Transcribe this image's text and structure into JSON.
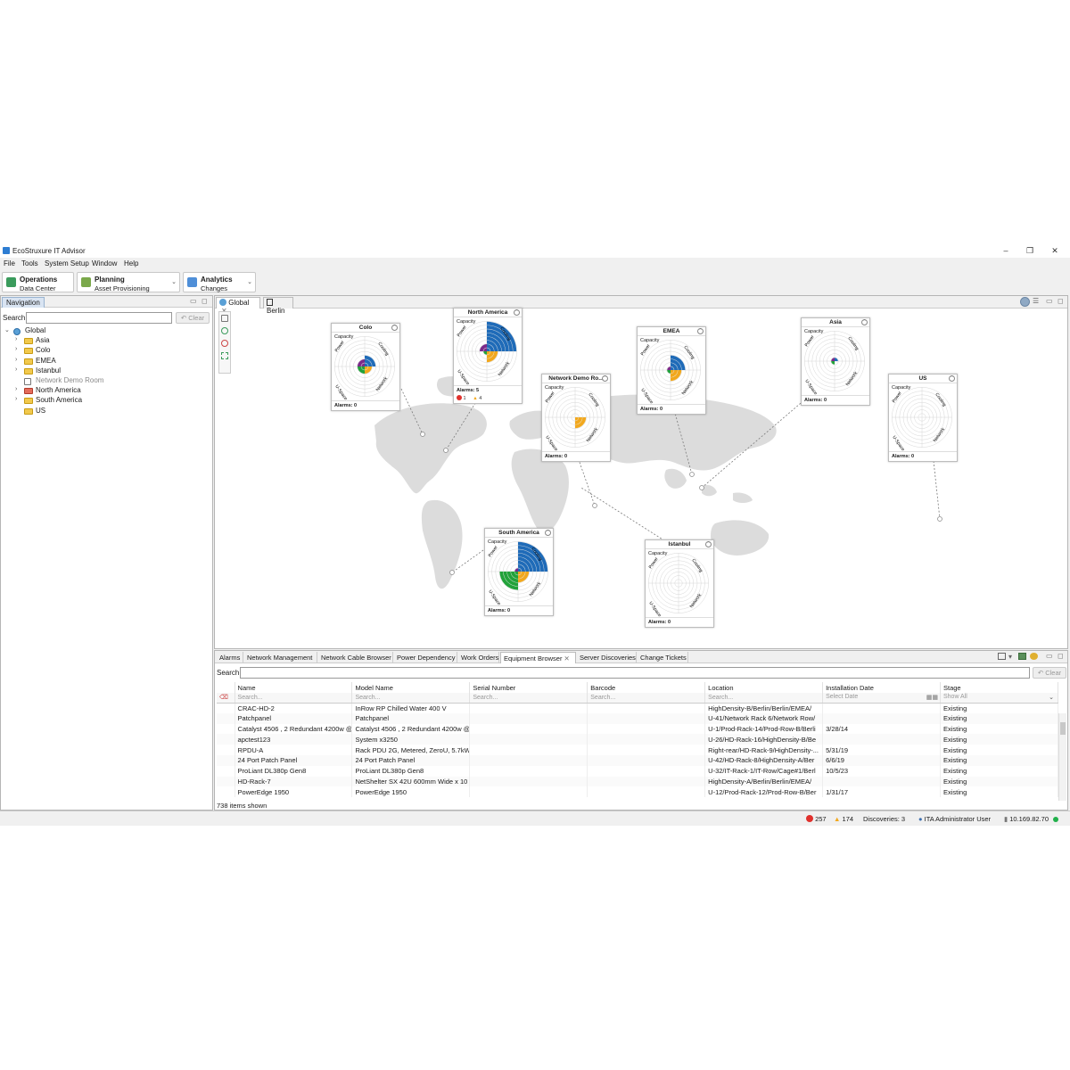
{
  "window": {
    "title": "EcoStruxure IT Advisor",
    "minimize": "–",
    "restore": "❐",
    "close": "✕"
  },
  "menu": [
    "File",
    "Tools",
    "System Setup",
    "Window",
    "Help"
  ],
  "perspectives": [
    {
      "title": "Operations",
      "subtitle": "Data Center",
      "icon": "operations-icon",
      "color": "#3a9b5c"
    },
    {
      "title": "Planning",
      "subtitle": "Asset Provisioning",
      "icon": "planning-icon",
      "color": "#7aa84a",
      "dropdown": "⌄"
    },
    {
      "title": "Analytics",
      "subtitle": "Changes",
      "icon": "analytics-icon",
      "color": "#4f8fd8",
      "dropdown": "⌄"
    }
  ],
  "navigation": {
    "tab": "Navigation",
    "search_label": "Search:",
    "search_value": "",
    "clear_label": "Clear",
    "tree": [
      {
        "label": "Global",
        "level": 0,
        "expanded": true,
        "type": "globe"
      },
      {
        "label": "Asia",
        "level": 1,
        "type": "folder"
      },
      {
        "label": "Colo",
        "level": 1,
        "type": "folder"
      },
      {
        "label": "EMEA",
        "level": 1,
        "type": "folder"
      },
      {
        "label": "Istanbul",
        "level": 1,
        "type": "folder"
      },
      {
        "label": "Network Demo Room",
        "level": 1,
        "type": "room",
        "muted": true
      },
      {
        "label": "North America",
        "level": 1,
        "type": "folder-red"
      },
      {
        "label": "South America",
        "level": 1,
        "type": "folder"
      },
      {
        "label": "US",
        "level": 1,
        "type": "folder",
        "leaf": true
      }
    ]
  },
  "map": {
    "tabs": [
      "Global",
      "Berlin"
    ],
    "capacity_label": "Capacity",
    "axis_labels": {
      "power": "Power",
      "cooling": "Cooling",
      "uspace": "U-Space",
      "network": "Network"
    },
    "alarms_prefix": "Alarms: ",
    "cards": [
      {
        "title": "Colo",
        "alarms": "0",
        "power": 2,
        "cooling": 3,
        "uspace": 2,
        "network": 2
      },
      {
        "title": "North America",
        "alarms": "5",
        "power": 2,
        "cooling": 8,
        "uspace": 1,
        "network": 3,
        "critical": "1",
        "warning": "4"
      },
      {
        "title": "Network Demo Ro...",
        "alarms": "0",
        "power": 0,
        "cooling": 0,
        "uspace": 0,
        "network": 3
      },
      {
        "title": "EMEA",
        "alarms": "0",
        "power": 1,
        "cooling": 4,
        "uspace": 1,
        "network": 3
      },
      {
        "title": "Asia",
        "alarms": "0",
        "power": 1,
        "cooling": 1,
        "uspace": 1,
        "network": 0
      },
      {
        "title": "US",
        "alarms": "0",
        "power": 0,
        "cooling": 0,
        "uspace": 0,
        "network": 0
      },
      {
        "title": "South America",
        "alarms": "0",
        "power": 1,
        "cooling": 8,
        "uspace": 5,
        "network": 3
      },
      {
        "title": "Istanbul",
        "alarms": "0",
        "power": 0,
        "cooling": 0,
        "uspace": 0,
        "network": 0
      }
    ]
  },
  "bottom": {
    "tabs": [
      "Alarms",
      "Network Management",
      "Network Cable Browser",
      "Power Dependency",
      "Work Orders",
      "Equipment Browser",
      "Server Discoveries",
      "Change Tickets"
    ],
    "active_tab": "Equipment Browser",
    "search_label": "Search:",
    "clear_label": "Clear",
    "columns": [
      "Name",
      "Model Name",
      "Serial Number",
      "Barcode",
      "Location",
      "Installation Date",
      "Stage"
    ],
    "filters": [
      "Search...",
      "Search...",
      "Search...",
      "Search...",
      "Search...",
      "Select Date",
      "Show All"
    ],
    "rows": [
      [
        "CRAC-HD-2",
        "InRow RP Chilled Water 400 V",
        "",
        "",
        "HighDensity-B/Berlin/Berlin/EMEA/",
        "",
        "Existing"
      ],
      [
        "Patchpanel",
        "Patchpanel",
        "",
        "",
        "U-41/Network Rack 6/Network Row/",
        "",
        "Existing"
      ],
      [
        "Catalyst 4506 , 2 Redundant 4200w @",
        "Catalyst 4506 , 2 Redundant 4200w @",
        "",
        "",
        "U-1/Prod-Rack-14/Prod-Row-B/Berli",
        "3/28/14",
        "Existing"
      ],
      [
        "apctest123",
        "System x3250",
        "",
        "",
        "U-26/HD-Rack-16/HighDensity-B/Be",
        "",
        "Existing"
      ],
      [
        "RPDU-A",
        "Rack PDU 2G, Metered, ZeroU, 5.7kW",
        "",
        "",
        "Right-rear/HD-Rack-9/HighDensity-...",
        "5/31/19",
        "Existing"
      ],
      [
        "24 Port Patch Panel",
        "24 Port Patch Panel",
        "",
        "",
        "U-42/HD-Rack-8/HighDensity-A/Ber",
        "6/6/19",
        "Existing"
      ],
      [
        "ProLiant DL380p Gen8",
        "ProLiant DL380p Gen8",
        "",
        "",
        "U-32/IT-Rack-1/IT-Row/Cage#1/Berl",
        "10/5/23",
        "Existing"
      ],
      [
        "HD-Rack-7",
        "NetShelter SX 42U 600mm Wide x 10",
        "",
        "",
        "HighDensity-A/Berlin/Berlin/EMEA/",
        "",
        "Existing"
      ],
      [
        "PowerEdge 1950",
        "PowerEdge 1950",
        "",
        "",
        "U-12/Prod-Rack-12/Prod-Row-B/Ber",
        "1/31/17",
        "Existing"
      ]
    ],
    "items_shown": "738 items shown"
  },
  "status": {
    "critical_count": "257",
    "warning_count": "174",
    "discoveries": "Discoveries: 3",
    "user": "ITA Administrator User",
    "ip": "10.169.82.70",
    "colors": {
      "critical": "#e0312d",
      "warning": "#f2a81d",
      "online": "#21b04b"
    }
  }
}
